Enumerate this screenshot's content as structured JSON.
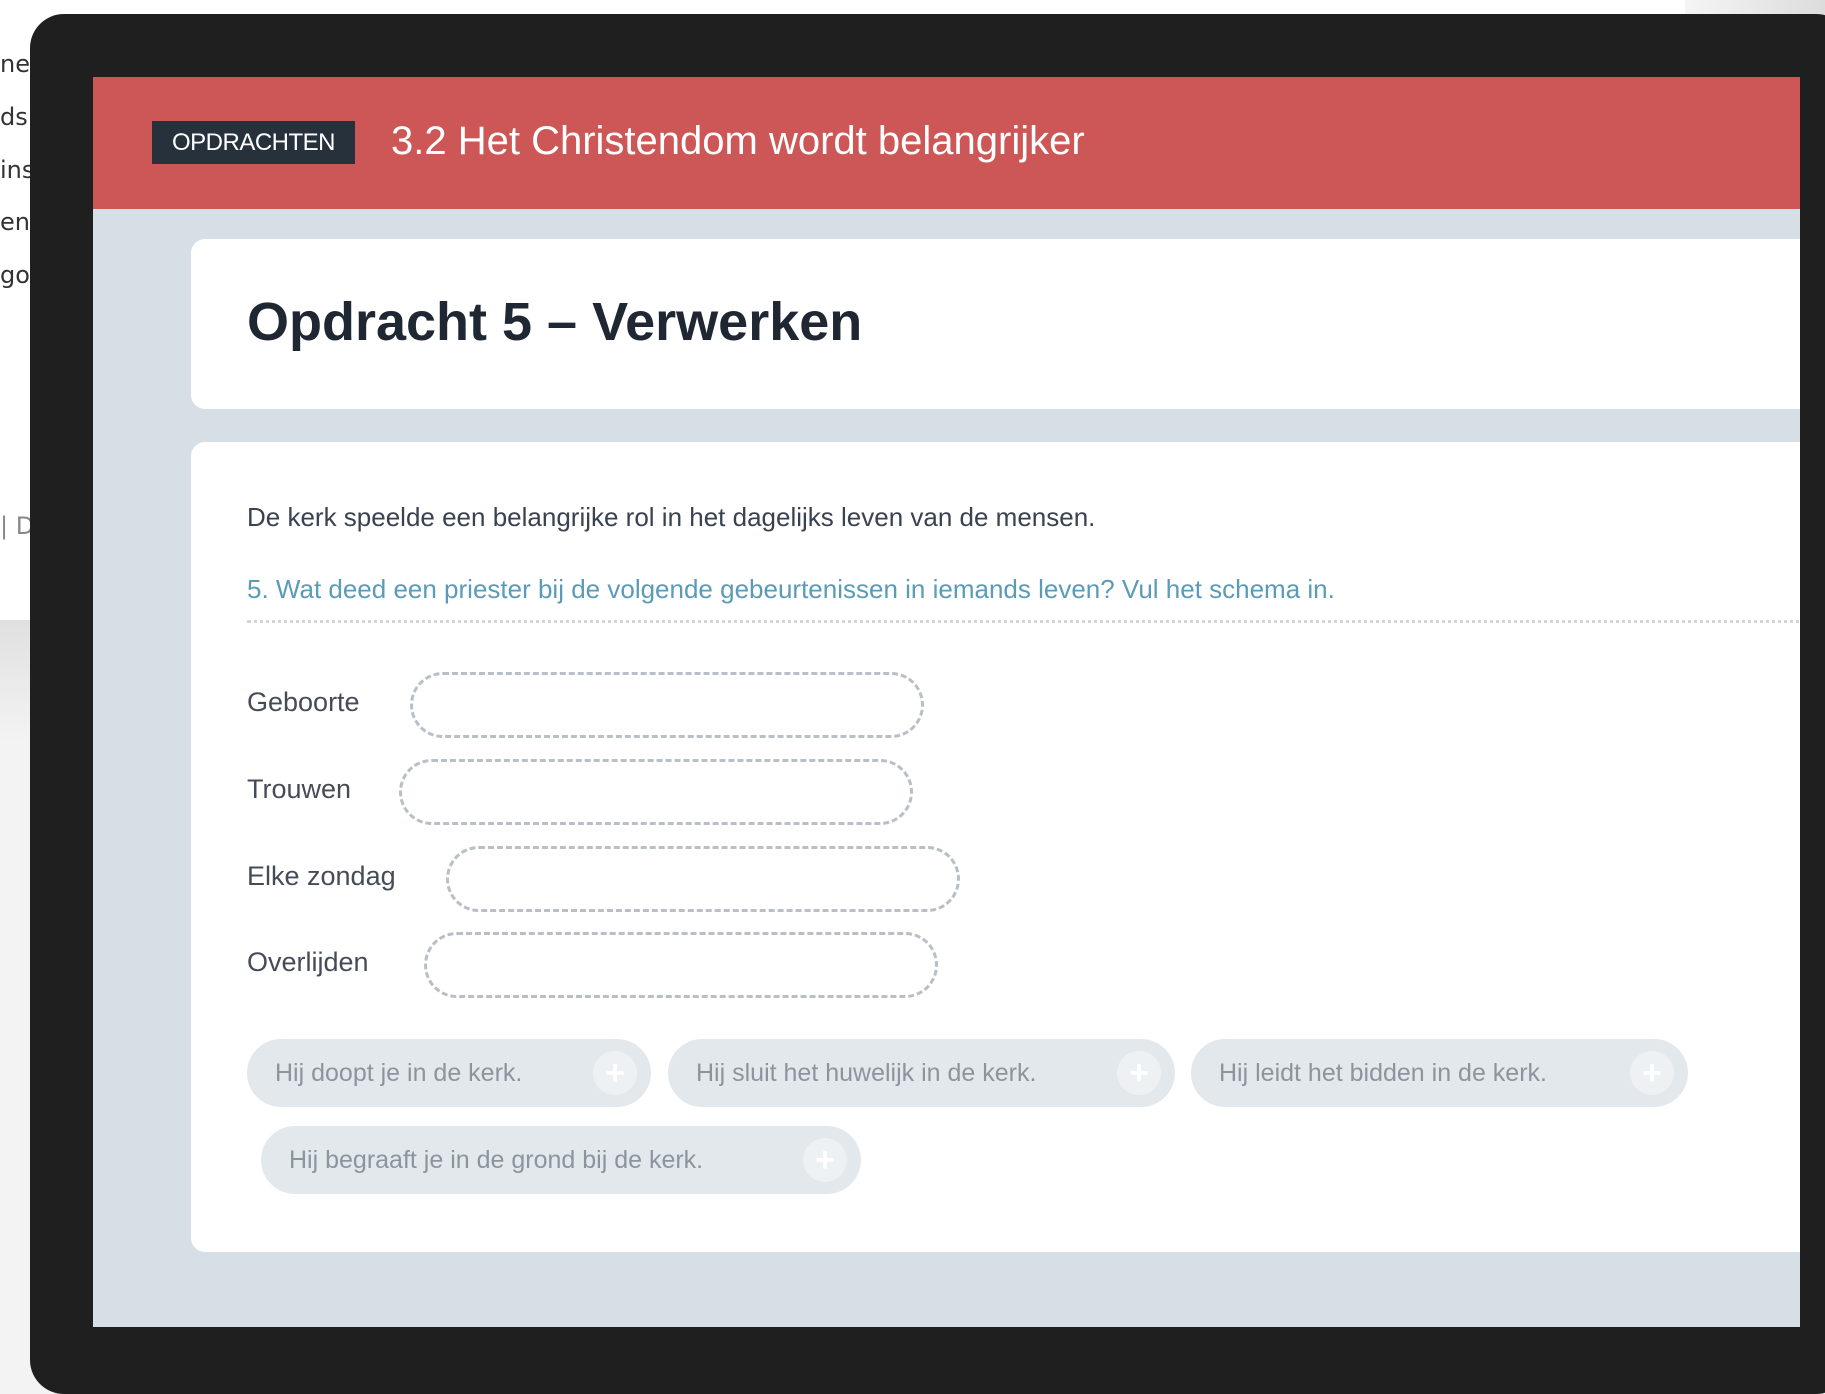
{
  "background_fragments": [
    "ne",
    "ds",
    "ins",
    "en",
    "go",
    "| D"
  ],
  "header": {
    "badge": "OPDRACHTEN",
    "title": "3.2 Het Christendom wordt belangrijker",
    "color": "#cd5656"
  },
  "exercise": {
    "title": "Opdracht 5 – Verwerken",
    "intro": "De kerk speelde een belangrijke rol in het dagelijks leven van de mensen.",
    "question": "5. Wat deed een priester bij de volgende gebeurtenissen in iemands leven? Vul het schema in.",
    "rows": [
      {
        "label": "Geboorte"
      },
      {
        "label": "Trouwen"
      },
      {
        "label": "Elke zondag"
      },
      {
        "label": "Overlijden"
      }
    ],
    "answers": [
      {
        "text": "Hij doopt je in de kerk.",
        "icon": "plus-icon"
      },
      {
        "text": "Hij sluit het huwelijk in de kerk.",
        "icon": "plus-icon"
      },
      {
        "text": "Hij leidt het bidden in de kerk.",
        "icon": "plus-icon"
      },
      {
        "text": "Hij begraaft je in de grond bij de kerk.",
        "icon": "plus-icon"
      }
    ]
  }
}
